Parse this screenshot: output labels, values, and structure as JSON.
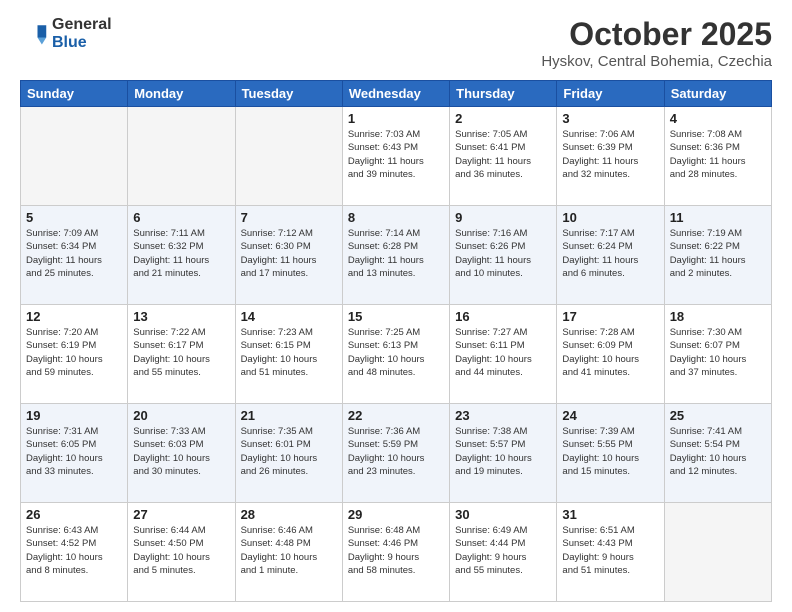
{
  "header": {
    "logo_general": "General",
    "logo_blue": "Blue",
    "month": "October 2025",
    "location": "Hyskov, Central Bohemia, Czechia"
  },
  "weekdays": [
    "Sunday",
    "Monday",
    "Tuesday",
    "Wednesday",
    "Thursday",
    "Friday",
    "Saturday"
  ],
  "weeks": [
    [
      {
        "day": "",
        "empty": true
      },
      {
        "day": "",
        "empty": true
      },
      {
        "day": "",
        "empty": true
      },
      {
        "day": "1",
        "info": "Sunrise: 7:03 AM\nSunset: 6:43 PM\nDaylight: 11 hours\nand 39 minutes."
      },
      {
        "day": "2",
        "info": "Sunrise: 7:05 AM\nSunset: 6:41 PM\nDaylight: 11 hours\nand 36 minutes."
      },
      {
        "day": "3",
        "info": "Sunrise: 7:06 AM\nSunset: 6:39 PM\nDaylight: 11 hours\nand 32 minutes."
      },
      {
        "day": "4",
        "info": "Sunrise: 7:08 AM\nSunset: 6:36 PM\nDaylight: 11 hours\nand 28 minutes."
      }
    ],
    [
      {
        "day": "5",
        "info": "Sunrise: 7:09 AM\nSunset: 6:34 PM\nDaylight: 11 hours\nand 25 minutes."
      },
      {
        "day": "6",
        "info": "Sunrise: 7:11 AM\nSunset: 6:32 PM\nDaylight: 11 hours\nand 21 minutes."
      },
      {
        "day": "7",
        "info": "Sunrise: 7:12 AM\nSunset: 6:30 PM\nDaylight: 11 hours\nand 17 minutes."
      },
      {
        "day": "8",
        "info": "Sunrise: 7:14 AM\nSunset: 6:28 PM\nDaylight: 11 hours\nand 13 minutes."
      },
      {
        "day": "9",
        "info": "Sunrise: 7:16 AM\nSunset: 6:26 PM\nDaylight: 11 hours\nand 10 minutes."
      },
      {
        "day": "10",
        "info": "Sunrise: 7:17 AM\nSunset: 6:24 PM\nDaylight: 11 hours\nand 6 minutes."
      },
      {
        "day": "11",
        "info": "Sunrise: 7:19 AM\nSunset: 6:22 PM\nDaylight: 11 hours\nand 2 minutes."
      }
    ],
    [
      {
        "day": "12",
        "info": "Sunrise: 7:20 AM\nSunset: 6:19 PM\nDaylight: 10 hours\nand 59 minutes."
      },
      {
        "day": "13",
        "info": "Sunrise: 7:22 AM\nSunset: 6:17 PM\nDaylight: 10 hours\nand 55 minutes."
      },
      {
        "day": "14",
        "info": "Sunrise: 7:23 AM\nSunset: 6:15 PM\nDaylight: 10 hours\nand 51 minutes."
      },
      {
        "day": "15",
        "info": "Sunrise: 7:25 AM\nSunset: 6:13 PM\nDaylight: 10 hours\nand 48 minutes."
      },
      {
        "day": "16",
        "info": "Sunrise: 7:27 AM\nSunset: 6:11 PM\nDaylight: 10 hours\nand 44 minutes."
      },
      {
        "day": "17",
        "info": "Sunrise: 7:28 AM\nSunset: 6:09 PM\nDaylight: 10 hours\nand 41 minutes."
      },
      {
        "day": "18",
        "info": "Sunrise: 7:30 AM\nSunset: 6:07 PM\nDaylight: 10 hours\nand 37 minutes."
      }
    ],
    [
      {
        "day": "19",
        "info": "Sunrise: 7:31 AM\nSunset: 6:05 PM\nDaylight: 10 hours\nand 33 minutes."
      },
      {
        "day": "20",
        "info": "Sunrise: 7:33 AM\nSunset: 6:03 PM\nDaylight: 10 hours\nand 30 minutes."
      },
      {
        "day": "21",
        "info": "Sunrise: 7:35 AM\nSunset: 6:01 PM\nDaylight: 10 hours\nand 26 minutes."
      },
      {
        "day": "22",
        "info": "Sunrise: 7:36 AM\nSunset: 5:59 PM\nDaylight: 10 hours\nand 23 minutes."
      },
      {
        "day": "23",
        "info": "Sunrise: 7:38 AM\nSunset: 5:57 PM\nDaylight: 10 hours\nand 19 minutes."
      },
      {
        "day": "24",
        "info": "Sunrise: 7:39 AM\nSunset: 5:55 PM\nDaylight: 10 hours\nand 15 minutes."
      },
      {
        "day": "25",
        "info": "Sunrise: 7:41 AM\nSunset: 5:54 PM\nDaylight: 10 hours\nand 12 minutes."
      }
    ],
    [
      {
        "day": "26",
        "info": "Sunrise: 6:43 AM\nSunset: 4:52 PM\nDaylight: 10 hours\nand 8 minutes."
      },
      {
        "day": "27",
        "info": "Sunrise: 6:44 AM\nSunset: 4:50 PM\nDaylight: 10 hours\nand 5 minutes."
      },
      {
        "day": "28",
        "info": "Sunrise: 6:46 AM\nSunset: 4:48 PM\nDaylight: 10 hours\nand 1 minute."
      },
      {
        "day": "29",
        "info": "Sunrise: 6:48 AM\nSunset: 4:46 PM\nDaylight: 9 hours\nand 58 minutes."
      },
      {
        "day": "30",
        "info": "Sunrise: 6:49 AM\nSunset: 4:44 PM\nDaylight: 9 hours\nand 55 minutes."
      },
      {
        "day": "31",
        "info": "Sunrise: 6:51 AM\nSunset: 4:43 PM\nDaylight: 9 hours\nand 51 minutes."
      },
      {
        "day": "",
        "empty": true
      }
    ]
  ]
}
